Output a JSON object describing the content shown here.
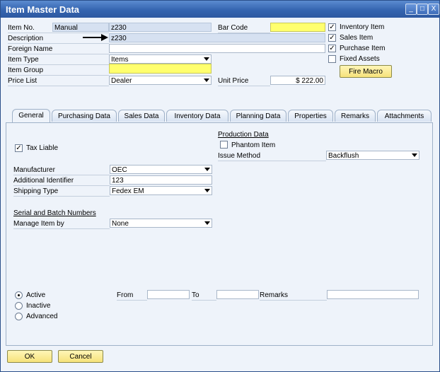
{
  "window": {
    "title": "Item Master Data",
    "controls": [
      "_",
      "□",
      "X"
    ]
  },
  "header": {
    "item_no_label": "Item No.",
    "item_no_series": "Manual",
    "item_no_value": "z230",
    "description_label": "Description",
    "description_value": "z230",
    "foreign_name_label": "Foreign Name",
    "foreign_name_value": "",
    "item_type_label": "Item Type",
    "item_type_value": "Items",
    "item_group_label": "Item Group",
    "item_group_value": "",
    "price_list_label": "Price List",
    "price_list_value": "Dealer",
    "bar_code_label": "Bar Code",
    "bar_code_value": "",
    "unit_price_label": "Unit Price",
    "unit_price_value": "$ 222.00"
  },
  "checkboxes": {
    "inventory_item": {
      "label": "Inventory Item",
      "checked": true
    },
    "sales_item": {
      "label": "Sales Item",
      "checked": true
    },
    "purchase_item": {
      "label": "Purchase Item",
      "checked": true
    },
    "fixed_assets": {
      "label": "Fixed Assets",
      "checked": false
    }
  },
  "fire_macro_label": "Fire Macro",
  "tabs": [
    "General",
    "Purchasing Data",
    "Sales Data",
    "Inventory Data",
    "Planning Data",
    "Properties",
    "Remarks",
    "Attachments"
  ],
  "general": {
    "tax_liable_label": "Tax Liable",
    "production_data_label": "Production Data",
    "phantom_item_label": "Phantom Item",
    "issue_method_label": "Issue Method",
    "issue_method_value": "Backflush",
    "manufacturer_label": "Manufacturer",
    "manufacturer_value": "OEC",
    "additional_identifier_label": "Additional Identifier",
    "additional_identifier_value": "123",
    "shipping_type_label": "Shipping Type",
    "shipping_type_value": "Fedex EM",
    "serial_batch_label": "Serial and Batch Numbers",
    "manage_item_by_label": "Manage Item by",
    "manage_item_by_value": "None",
    "status": {
      "active": "Active",
      "inactive": "Inactive",
      "advanced": "Advanced"
    },
    "from_label": "From",
    "to_label": "To",
    "remarks_label": "Remarks"
  },
  "footer": {
    "ok_label": "OK",
    "cancel_label": "Cancel"
  },
  "colors": {
    "titlebar": "#3565b0",
    "required_field": "#ffff6e",
    "button": "#f6e27a",
    "panel": "#eef3fa"
  }
}
